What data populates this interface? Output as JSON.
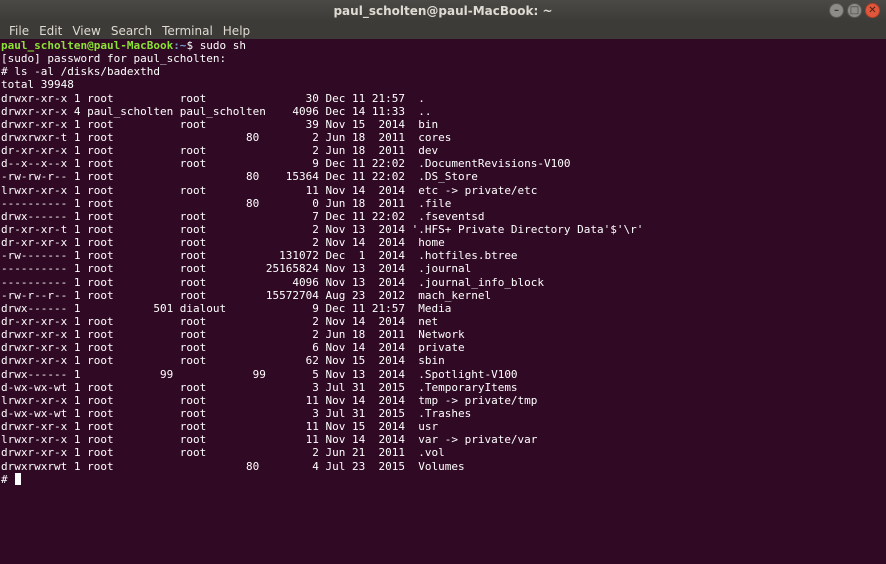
{
  "window": {
    "title": "paul_scholten@paul-MacBook: ~"
  },
  "menu": [
    "File",
    "Edit",
    "View",
    "Search",
    "Terminal",
    "Help"
  ],
  "prompt": {
    "user_host": "paul_scholten@paul-MacBook",
    "path": ":~",
    "symbol": "$ ",
    "command": "sudo sh"
  },
  "lines": [
    "[sudo] password for paul_scholten:",
    "# ls -al /disks/badexthd",
    "total 39948",
    "drwxr-xr-x 1 root          root               30 Dec 11 21:57  .",
    "drwxr-xr-x 4 paul_scholten paul_scholten    4096 Dec 14 11:33  ..",
    "drwxr-xr-x 1 root          root               39 Nov 15  2014  bin",
    "drwxrwxr-t 1 root                    80        2 Jun 18  2011  cores",
    "dr-xr-xr-x 1 root          root                2 Jun 18  2011  dev",
    "d--x--x--x 1 root          root                9 Dec 11 22:02  .DocumentRevisions-V100",
    "-rw-rw-r-- 1 root                    80    15364 Dec 11 22:02  .DS_Store",
    "lrwxr-xr-x 1 root          root               11 Nov 14  2014  etc -> private/etc",
    "---------- 1 root                    80        0 Jun 18  2011  .file",
    "drwx------ 1 root          root                7 Dec 11 22:02  .fseventsd",
    "dr-xr-xr-t 1 root          root                2 Nov 13  2014 '.HFS+ Private Directory Data'$'\\r'",
    "dr-xr-xr-x 1 root          root                2 Nov 14  2014  home",
    "-rw------- 1 root          root           131072 Dec  1  2014  .hotfiles.btree",
    "---------- 1 root          root         25165824 Nov 13  2014  .journal",
    "---------- 1 root          root             4096 Nov 13  2014  .journal_info_block",
    "-rw-r--r-- 1 root          root         15572704 Aug 23  2012  mach_kernel",
    "drwx------ 1           501 dialout             9 Dec 11 21:57  Media",
    "dr-xr-xr-x 1 root          root                2 Nov 14  2014  net",
    "drwxr-xr-x 1 root          root                2 Jun 18  2011  Network",
    "drwxr-xr-x 1 root          root                6 Nov 14  2014  private",
    "drwxr-xr-x 1 root          root               62 Nov 15  2014  sbin",
    "drwx------ 1            99            99       5 Nov 13  2014  .Spotlight-V100",
    "d-wx-wx-wt 1 root          root                3 Jul 31  2015  .TemporaryItems",
    "lrwxr-xr-x 1 root          root               11 Nov 14  2014  tmp -> private/tmp",
    "d-wx-wx-wt 1 root          root                3 Jul 31  2015  .Trashes",
    "drwxr-xr-x 1 root          root               11 Nov 15  2014  usr",
    "lrwxr-xr-x 1 root          root               11 Nov 14  2014  var -> private/var",
    "drwxr-xr-x 1 root          root                2 Jun 21  2011  .vol",
    "drwxrwxrwt 1 root                    80        4 Jul 23  2015  Volumes"
  ],
  "final_prompt": "#"
}
